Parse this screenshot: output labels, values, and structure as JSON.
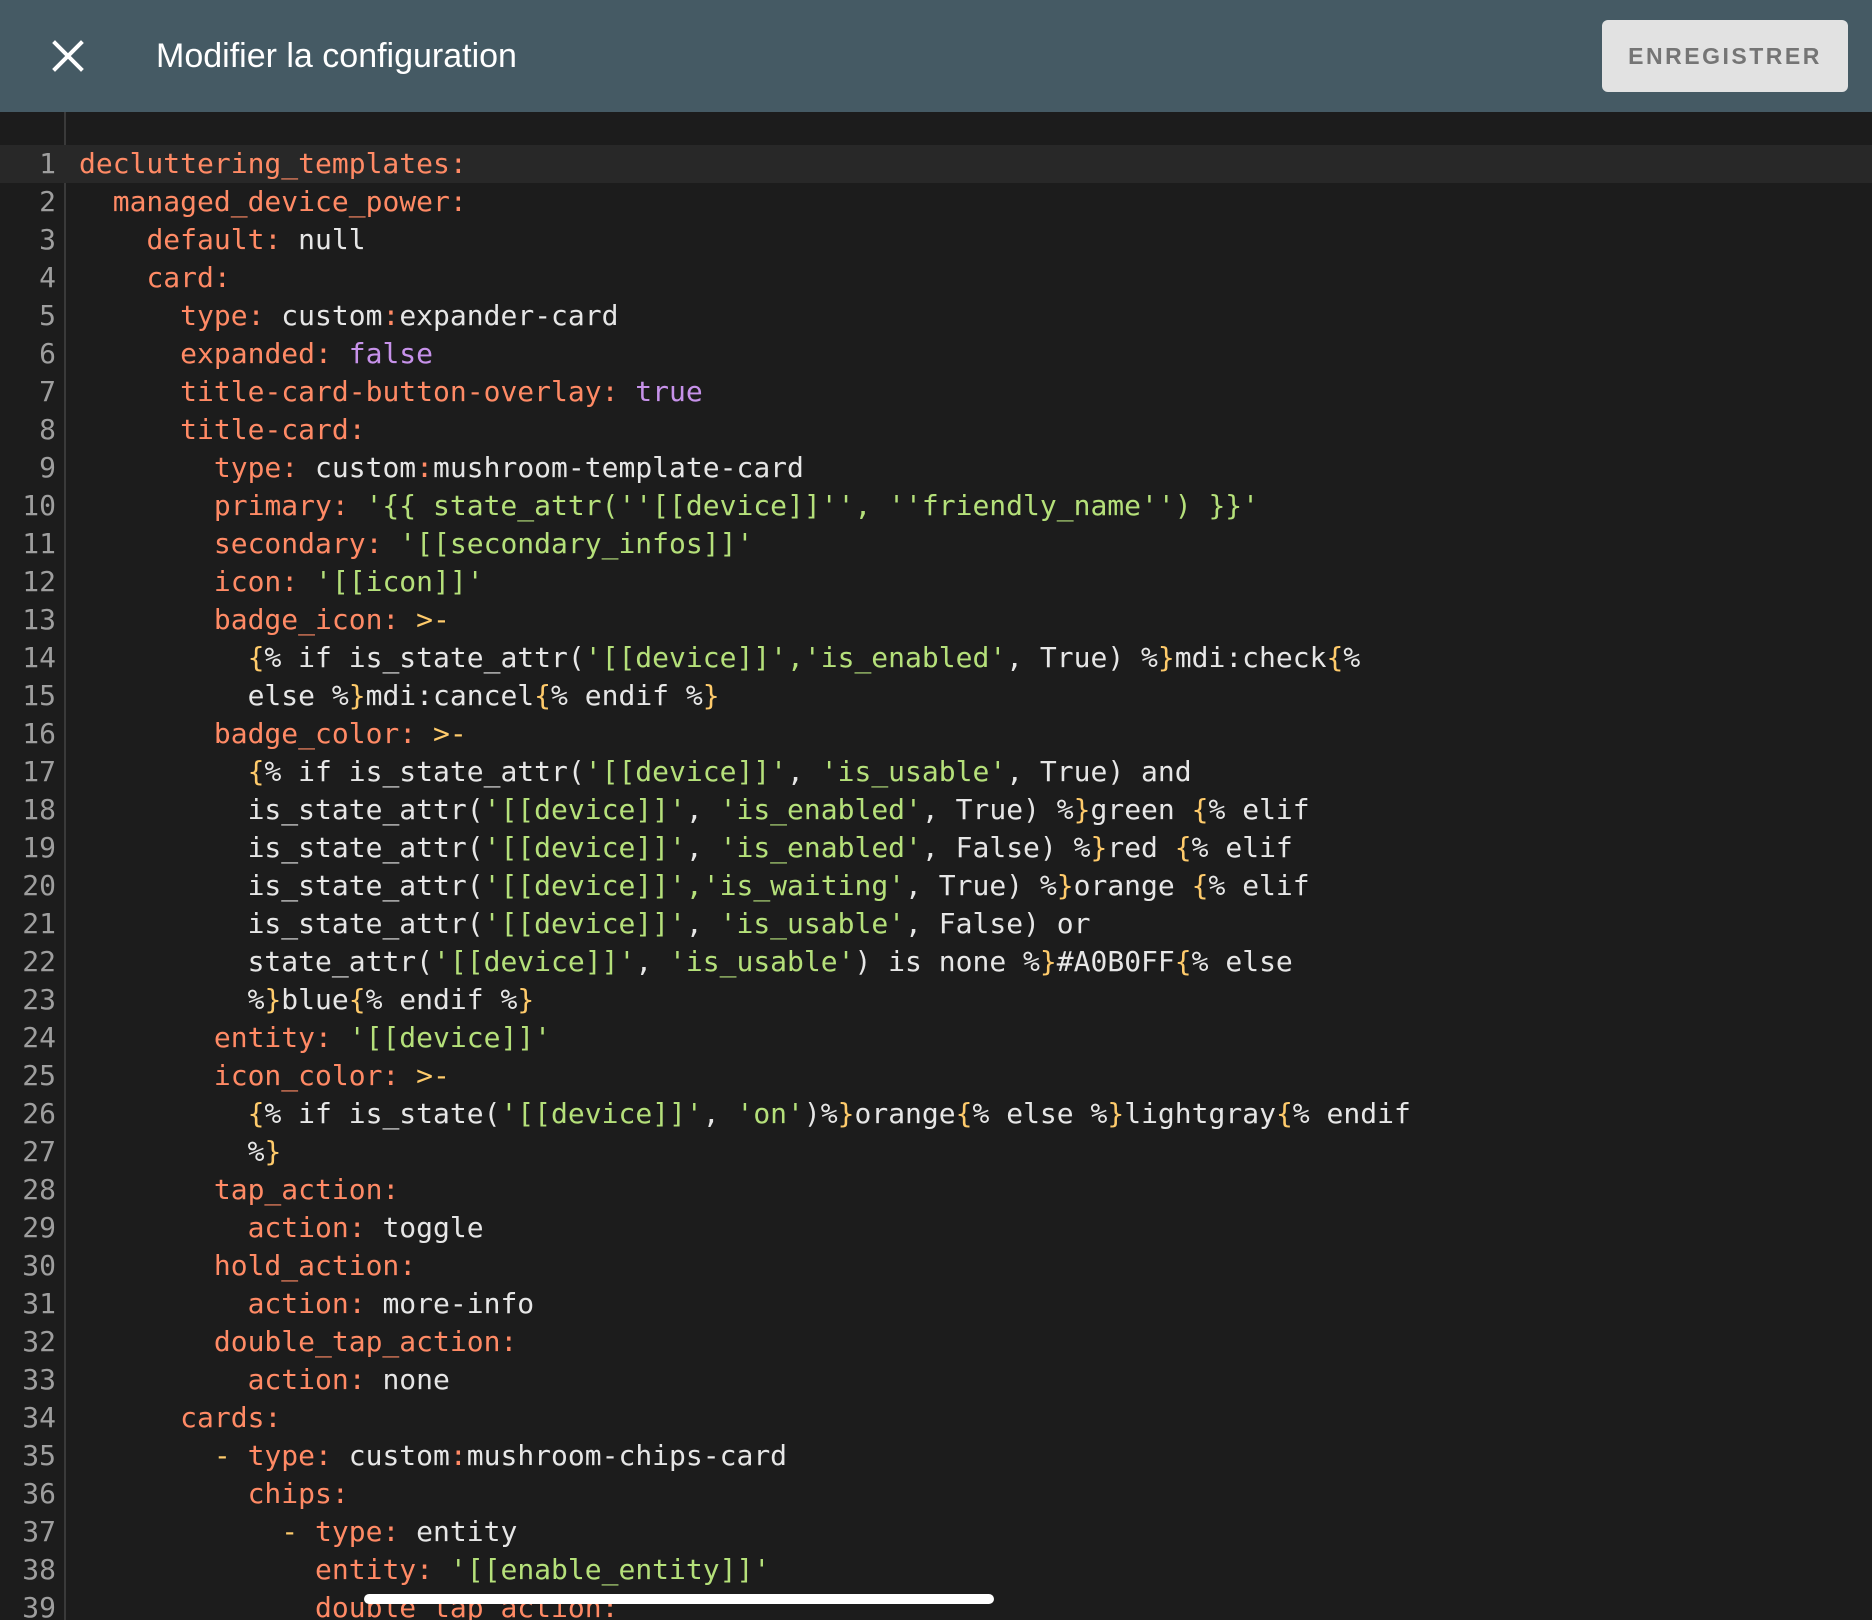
{
  "header": {
    "title": "Modifier la configuration",
    "save_label": "ENREGISTRER",
    "close_icon": "close-icon"
  },
  "colors": {
    "header_bg": "#455a64",
    "editor_bg": "#1c1c1c",
    "key": "#ff8a65",
    "string": "#b5e07a",
    "boolean": "#c792ea",
    "template_brace": "#ffcb6b"
  },
  "editor": {
    "language": "yaml",
    "active_line": 1,
    "lines": [
      {
        "n": "1",
        "indent": "",
        "tokens": [
          [
            "k",
            "decluttering_templates:"
          ]
        ]
      },
      {
        "n": "2",
        "indent": "  ",
        "tokens": [
          [
            "k",
            "managed_device_power:"
          ]
        ]
      },
      {
        "n": "3",
        "indent": "    ",
        "tokens": [
          [
            "k",
            "default:"
          ],
          [
            "t",
            " null"
          ]
        ]
      },
      {
        "n": "4",
        "indent": "    ",
        "tokens": [
          [
            "k",
            "card:"
          ]
        ]
      },
      {
        "n": "5",
        "indent": "      ",
        "tokens": [
          [
            "k",
            "type:"
          ],
          [
            "t",
            " custom"
          ],
          [
            "k",
            ":"
          ],
          [
            "t",
            "expander-card"
          ]
        ]
      },
      {
        "n": "6",
        "indent": "      ",
        "tokens": [
          [
            "k",
            "expanded:"
          ],
          [
            "b",
            " false"
          ]
        ]
      },
      {
        "n": "7",
        "indent": "      ",
        "tokens": [
          [
            "k",
            "title-card-button-overlay:"
          ],
          [
            "b",
            " true"
          ]
        ]
      },
      {
        "n": "8",
        "indent": "      ",
        "tokens": [
          [
            "k",
            "title-card:"
          ]
        ]
      },
      {
        "n": "9",
        "indent": "        ",
        "tokens": [
          [
            "k",
            "type:"
          ],
          [
            "t",
            " custom"
          ],
          [
            "k",
            ":"
          ],
          [
            "t",
            "mushroom-template-card"
          ]
        ]
      },
      {
        "n": "10",
        "indent": "        ",
        "tokens": [
          [
            "k",
            "primary:"
          ],
          [
            "s",
            " '{{ state_attr(''[[device]]'', ''friendly_name'') }}'"
          ]
        ]
      },
      {
        "n": "11",
        "indent": "        ",
        "tokens": [
          [
            "k",
            "secondary:"
          ],
          [
            "s",
            " '[[secondary_infos]]'"
          ]
        ]
      },
      {
        "n": "12",
        "indent": "        ",
        "tokens": [
          [
            "k",
            "icon:"
          ],
          [
            "s",
            " '[[icon]]'"
          ]
        ]
      },
      {
        "n": "13",
        "indent": "        ",
        "tokens": [
          [
            "k",
            "badge_icon:"
          ],
          [
            "p",
            " >-"
          ]
        ]
      },
      {
        "n": "14",
        "indent": "          ",
        "tokens": [
          [
            "p",
            "{"
          ],
          [
            "t",
            "% if is_state_attr("
          ],
          [
            "s",
            "'[[device]]','is_enabled'"
          ],
          [
            "t",
            ", True) %"
          ],
          [
            "p",
            "}"
          ],
          [
            "t",
            "mdi:check"
          ],
          [
            "p",
            "{"
          ],
          [
            "t",
            "%"
          ]
        ]
      },
      {
        "n": "15",
        "indent": "          ",
        "tokens": [
          [
            "t",
            "else %"
          ],
          [
            "p",
            "}"
          ],
          [
            "t",
            "mdi:cancel"
          ],
          [
            "p",
            "{"
          ],
          [
            "t",
            "% endif %"
          ],
          [
            "p",
            "}"
          ]
        ]
      },
      {
        "n": "16",
        "indent": "        ",
        "tokens": [
          [
            "k",
            "badge_color:"
          ],
          [
            "p",
            " >-"
          ]
        ]
      },
      {
        "n": "17",
        "indent": "          ",
        "tokens": [
          [
            "p",
            "{"
          ],
          [
            "t",
            "% if is_state_attr("
          ],
          [
            "s",
            "'[[device]]'"
          ],
          [
            "t",
            ", "
          ],
          [
            "s",
            "'is_usable'"
          ],
          [
            "t",
            ", True) and"
          ]
        ]
      },
      {
        "n": "18",
        "indent": "          ",
        "tokens": [
          [
            "t",
            "is_state_attr("
          ],
          [
            "s",
            "'[[device]]'"
          ],
          [
            "t",
            ", "
          ],
          [
            "s",
            "'is_enabled'"
          ],
          [
            "t",
            ", True) %"
          ],
          [
            "p",
            "}"
          ],
          [
            "t",
            "green "
          ],
          [
            "p",
            "{"
          ],
          [
            "t",
            "% elif"
          ]
        ]
      },
      {
        "n": "19",
        "indent": "          ",
        "tokens": [
          [
            "t",
            "is_state_attr("
          ],
          [
            "s",
            "'[[device]]'"
          ],
          [
            "t",
            ", "
          ],
          [
            "s",
            "'is_enabled'"
          ],
          [
            "t",
            ", False) %"
          ],
          [
            "p",
            "}"
          ],
          [
            "t",
            "red "
          ],
          [
            "p",
            "{"
          ],
          [
            "t",
            "% elif"
          ]
        ]
      },
      {
        "n": "20",
        "indent": "          ",
        "tokens": [
          [
            "t",
            "is_state_attr("
          ],
          [
            "s",
            "'[[device]]','is_waiting'"
          ],
          [
            "t",
            ", True) %"
          ],
          [
            "p",
            "}"
          ],
          [
            "t",
            "orange "
          ],
          [
            "p",
            "{"
          ],
          [
            "t",
            "% elif"
          ]
        ]
      },
      {
        "n": "21",
        "indent": "          ",
        "tokens": [
          [
            "t",
            "is_state_attr("
          ],
          [
            "s",
            "'[[device]]'"
          ],
          [
            "t",
            ", "
          ],
          [
            "s",
            "'is_usable'"
          ],
          [
            "t",
            ", False) or"
          ]
        ]
      },
      {
        "n": "22",
        "indent": "          ",
        "tokens": [
          [
            "t",
            "state_attr("
          ],
          [
            "s",
            "'[[device]]'"
          ],
          [
            "t",
            ", "
          ],
          [
            "s",
            "'is_usable'"
          ],
          [
            "t",
            ") is none %"
          ],
          [
            "p",
            "}"
          ],
          [
            "t",
            "#A0B0FF"
          ],
          [
            "p",
            "{"
          ],
          [
            "t",
            "% else"
          ]
        ]
      },
      {
        "n": "23",
        "indent": "          ",
        "tokens": [
          [
            "t",
            "%"
          ],
          [
            "p",
            "}"
          ],
          [
            "t",
            "blue"
          ],
          [
            "p",
            "{"
          ],
          [
            "t",
            "% endif %"
          ],
          [
            "p",
            "}"
          ]
        ]
      },
      {
        "n": "24",
        "indent": "        ",
        "tokens": [
          [
            "k",
            "entity:"
          ],
          [
            "s",
            " '[[device]]'"
          ]
        ]
      },
      {
        "n": "25",
        "indent": "        ",
        "tokens": [
          [
            "k",
            "icon_color:"
          ],
          [
            "p",
            " >-"
          ]
        ]
      },
      {
        "n": "26",
        "indent": "          ",
        "tokens": [
          [
            "p",
            "{"
          ],
          [
            "t",
            "% if is_state("
          ],
          [
            "s",
            "'[[device]]'"
          ],
          [
            "t",
            ", "
          ],
          [
            "s",
            "'on'"
          ],
          [
            "t",
            ")%"
          ],
          [
            "p",
            "}"
          ],
          [
            "t",
            "orange"
          ],
          [
            "p",
            "{"
          ],
          [
            "t",
            "% else %"
          ],
          [
            "p",
            "}"
          ],
          [
            "t",
            "lightgray"
          ],
          [
            "p",
            "{"
          ],
          [
            "t",
            "% endif"
          ]
        ]
      },
      {
        "n": "27",
        "indent": "          ",
        "tokens": [
          [
            "t",
            "%"
          ],
          [
            "p",
            "}"
          ]
        ]
      },
      {
        "n": "28",
        "indent": "        ",
        "tokens": [
          [
            "k",
            "tap_action:"
          ]
        ]
      },
      {
        "n": "29",
        "indent": "          ",
        "tokens": [
          [
            "k",
            "action:"
          ],
          [
            "t",
            " toggle"
          ]
        ]
      },
      {
        "n": "30",
        "indent": "        ",
        "tokens": [
          [
            "k",
            "hold_action:"
          ]
        ]
      },
      {
        "n": "31",
        "indent": "          ",
        "tokens": [
          [
            "k",
            "action:"
          ],
          [
            "t",
            " more-info"
          ]
        ]
      },
      {
        "n": "32",
        "indent": "        ",
        "tokens": [
          [
            "k",
            "double_tap_action:"
          ]
        ]
      },
      {
        "n": "33",
        "indent": "          ",
        "tokens": [
          [
            "k",
            "action:"
          ],
          [
            "t",
            " none"
          ]
        ]
      },
      {
        "n": "34",
        "indent": "      ",
        "tokens": [
          [
            "k",
            "cards:"
          ]
        ]
      },
      {
        "n": "35",
        "indent": "        ",
        "tokens": [
          [
            "p",
            "- "
          ],
          [
            "k",
            "type:"
          ],
          [
            "t",
            " custom"
          ],
          [
            "k",
            ":"
          ],
          [
            "t",
            "mushroom-chips-card"
          ]
        ]
      },
      {
        "n": "36",
        "indent": "          ",
        "tokens": [
          [
            "k",
            "chips:"
          ]
        ]
      },
      {
        "n": "37",
        "indent": "            ",
        "tokens": [
          [
            "p",
            "- "
          ],
          [
            "k",
            "type:"
          ],
          [
            "t",
            " entity"
          ]
        ]
      },
      {
        "n": "38",
        "indent": "              ",
        "tokens": [
          [
            "k",
            "entity:"
          ],
          [
            "s",
            " '[[enable_entity]]'"
          ]
        ]
      },
      {
        "n": "39",
        "indent": "              ",
        "tokens": [
          [
            "k",
            "double_tap_action:"
          ]
        ]
      }
    ]
  }
}
